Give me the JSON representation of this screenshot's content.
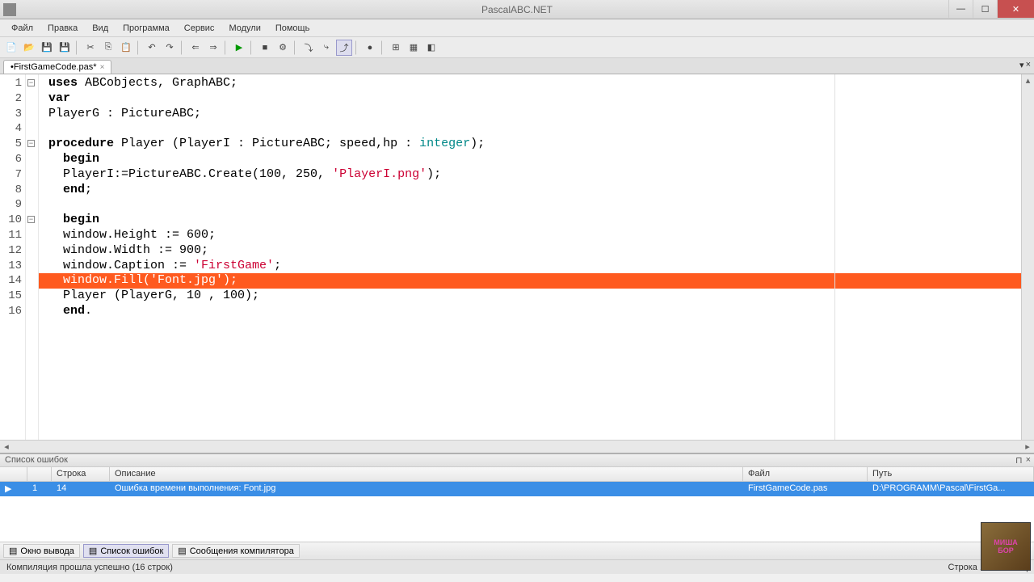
{
  "window": {
    "title": "PascalABC.NET"
  },
  "menu": [
    "Файл",
    "Правка",
    "Вид",
    "Программа",
    "Сервис",
    "Модули",
    "Помощь"
  ],
  "tab": {
    "label": "•FirstGameCode.pas*"
  },
  "code": {
    "lines": [
      {
        "n": 1,
        "tokens": [
          [
            "kw",
            "uses"
          ],
          [
            "",
            " ABCobjects, GraphABC;"
          ]
        ]
      },
      {
        "n": 2,
        "tokens": [
          [
            "kw",
            "var"
          ]
        ]
      },
      {
        "n": 3,
        "tokens": [
          [
            "",
            "PlayerG : PictureABC;"
          ]
        ]
      },
      {
        "n": 4,
        "tokens": []
      },
      {
        "n": 5,
        "tokens": [
          [
            "kw",
            "procedure"
          ],
          [
            "",
            " Player (PlayerI : PictureABC; speed,hp : "
          ],
          [
            "type",
            "integer"
          ],
          [
            "",
            ");"
          ]
        ]
      },
      {
        "n": 6,
        "tokens": [
          [
            "",
            "  "
          ],
          [
            "kw",
            "begin"
          ]
        ]
      },
      {
        "n": 7,
        "tokens": [
          [
            "",
            "  PlayerI:=PictureABC.Create(100, 250, "
          ],
          [
            "str",
            "'PlayerI.png'"
          ],
          [
            "",
            ");"
          ]
        ]
      },
      {
        "n": 8,
        "tokens": [
          [
            "",
            "  "
          ],
          [
            "kw",
            "end"
          ],
          [
            "",
            ";"
          ]
        ]
      },
      {
        "n": 9,
        "tokens": []
      },
      {
        "n": 10,
        "tokens": [
          [
            "",
            "  "
          ],
          [
            "kw",
            "begin"
          ]
        ]
      },
      {
        "n": 11,
        "tokens": [
          [
            "",
            "  window.Height := 600;"
          ]
        ]
      },
      {
        "n": 12,
        "tokens": [
          [
            "",
            "  window.Width := 900;"
          ]
        ]
      },
      {
        "n": 13,
        "tokens": [
          [
            "",
            "  window.Caption := "
          ],
          [
            "str",
            "'FirstGame'"
          ],
          [
            "",
            ";"
          ]
        ]
      },
      {
        "n": 14,
        "err": true,
        "tokens": [
          [
            "",
            "  window.Fill('Font.jpg');"
          ]
        ]
      },
      {
        "n": 15,
        "tokens": [
          [
            "",
            "  Player (PlayerG, 10 , 100);"
          ]
        ]
      },
      {
        "n": 16,
        "tokens": [
          [
            "",
            "  "
          ],
          [
            "kw",
            "end"
          ],
          [
            "",
            "."
          ]
        ]
      }
    ],
    "folds": {
      "1": "⊟",
      "5": "⊟",
      "10": "⊟"
    }
  },
  "errorPanel": {
    "title": "Список ошибок",
    "columns": {
      "num": "",
      "line": "Строка",
      "desc": "Описание",
      "file": "Файл",
      "path": "Путь"
    },
    "row": {
      "num": "1",
      "line": "14",
      "desc": "Ошибка времени выполнения: Font.jpg",
      "file": "FirstGameCode.pas",
      "path": "D:\\PROGRAMM\\Pascal\\FirstGa..."
    }
  },
  "bottomTabs": {
    "output": "Окно вывода",
    "errors": "Список ошибок",
    "compiler": "Сообщения компилятора"
  },
  "status": {
    "left": "Компиляция прошла успешно (16 строк)",
    "right": "Строка  14 Столбец"
  }
}
